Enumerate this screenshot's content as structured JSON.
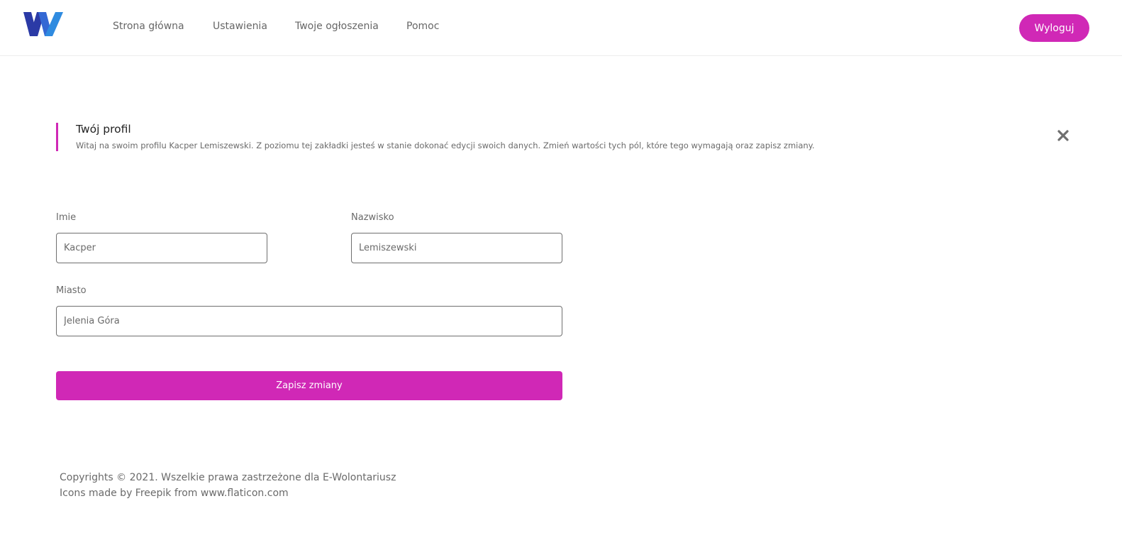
{
  "nav": {
    "links": [
      "Strona główna",
      "Ustawienia",
      "Twoje ogłoszenia",
      "Pomoc"
    ],
    "logout_label": "Wyloguj"
  },
  "alert": {
    "title": "Twój profil",
    "text": "Witaj na swoim profilu Kacper Lemiszewski. Z poziomu tej zakładki jesteś w stanie dokonać edycji swoich danych. Zmień wartości tych pól, które tego wymagają oraz zapisz zmiany.",
    "close_icon": "close-icon"
  },
  "form": {
    "first_name_label": "Imie",
    "first_name_value": "Kacper",
    "last_name_label": "Nazwisko",
    "last_name_value": "Lemiszewski",
    "city_label": "Miasto",
    "city_value": "Jelenia Góra",
    "save_label": "Zapisz zmiany"
  },
  "footer": {
    "copyright": "Copyrights © 2021. Wszelkie prawa zastrzeżone dla E-Wolontariusz",
    "credits": "Icons made by Freepik from www.flaticon.com"
  },
  "colors": {
    "accent": "#d028b6",
    "logo_dark": "#2b3aa6",
    "logo_light": "#2f8be0"
  }
}
